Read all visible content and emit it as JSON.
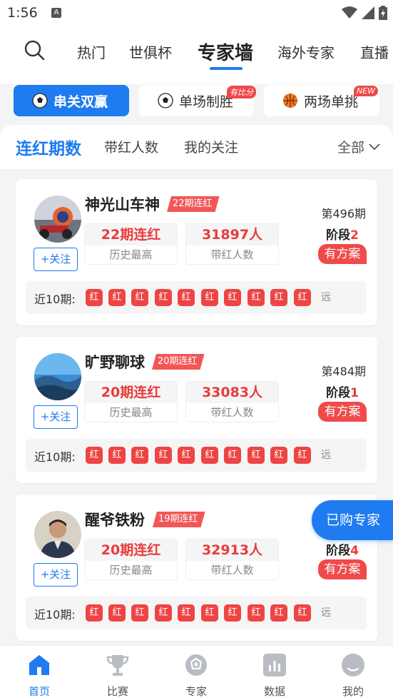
{
  "status_bar": {
    "time": "1:56",
    "notif_icon": "A"
  },
  "header": {
    "tabs": [
      "热门",
      "世俱杯",
      "专家墙",
      "海外专家",
      "直播"
    ],
    "active_tab": "专家墙"
  },
  "modes": [
    {
      "label": "串关双赢",
      "icon": "soccer-ball-icon",
      "active": true
    },
    {
      "label": "单场制胜",
      "icon": "soccer-ball-icon",
      "badge": "有比分"
    },
    {
      "label": "两场单挑",
      "icon": "basketball-icon",
      "badge": "NEW"
    }
  ],
  "sub_tabs": [
    "连红期数",
    "带红人数",
    "我的关注"
  ],
  "filter": {
    "label": "全部"
  },
  "experts": [
    {
      "name": "神光山车神",
      "streak_tag": "22期连红",
      "follow": "+关注",
      "max_streak": "22期连红",
      "max_streak_label": "历史最高",
      "followers": "31897人",
      "followers_label": "带红人数",
      "period": "第496期",
      "stage_label": "阶段",
      "stage_num": "2",
      "plan": "有方案",
      "recent_label": "近10期:",
      "recent": [
        "红",
        "红",
        "红",
        "红",
        "红",
        "红",
        "红",
        "红",
        "红",
        "红"
      ],
      "recent_more": "远"
    },
    {
      "name": "旷野聊球",
      "streak_tag": "20期连红",
      "follow": "+关注",
      "max_streak": "20期连红",
      "max_streak_label": "历史最高",
      "followers": "33083人",
      "followers_label": "带红人数",
      "period": "第484期",
      "stage_label": "阶段",
      "stage_num": "1",
      "plan": "有方案",
      "recent_label": "近10期:",
      "recent": [
        "红",
        "红",
        "红",
        "红",
        "红",
        "红",
        "红",
        "红",
        "红",
        "红"
      ],
      "recent_more": "远"
    },
    {
      "name": "醒爷铁粉",
      "streak_tag": "19期连红",
      "follow": "+关注",
      "max_streak": "20期连红",
      "max_streak_label": "历史最高",
      "followers": "32913人",
      "followers_label": "带红人数",
      "period": "",
      "stage_label": "阶段",
      "stage_num": "4",
      "plan": "有方案",
      "recent_label": "近10期:",
      "recent": [
        "红",
        "红",
        "红",
        "红",
        "红",
        "红",
        "红",
        "红",
        "红",
        "红"
      ],
      "recent_more": "远"
    }
  ],
  "floating_button": "已购专家",
  "bottom_nav": [
    {
      "label": "首页",
      "icon": "home-icon",
      "active": true
    },
    {
      "label": "比赛",
      "icon": "trophy-icon"
    },
    {
      "label": "专家",
      "icon": "expert-badge-icon"
    },
    {
      "label": "数据",
      "icon": "bar-chart-icon"
    },
    {
      "label": "我的",
      "icon": "profile-icon"
    }
  ],
  "colors": {
    "accent": "#1f7bf0",
    "red": "#ee4444"
  }
}
